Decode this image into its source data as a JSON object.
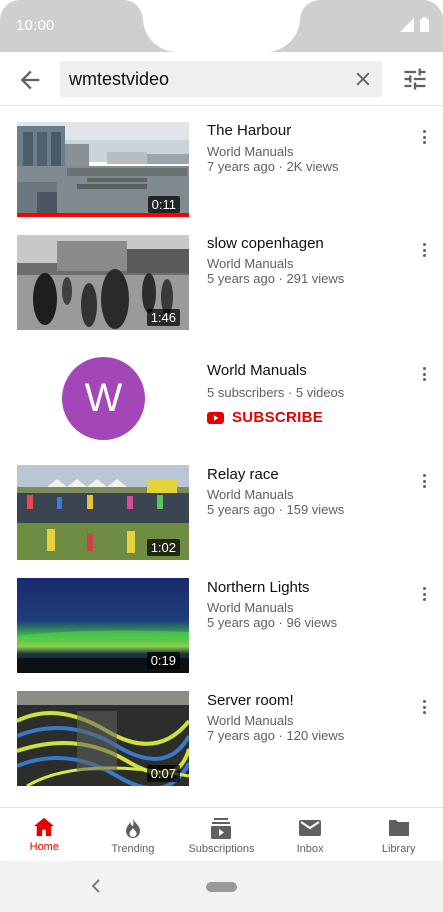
{
  "status_bar": {
    "time": "10:00"
  },
  "search": {
    "query": "wmtestvideo"
  },
  "videos": [
    {
      "title": "The Harbour",
      "channel": "World Manuals",
      "meta": "7 years ago · 2K views",
      "duration": "0:11",
      "watched_fraction": 1.0
    },
    {
      "title": "slow copenhagen",
      "channel": "World Manuals",
      "meta": "5 years ago · 291 views",
      "duration": "1:46"
    },
    {
      "title": "Relay race",
      "channel": "World Manuals",
      "meta": "5 years ago · 159 views",
      "duration": "1:02"
    },
    {
      "title": "Northern Lights",
      "channel": "World Manuals",
      "meta": "5 years ago · 96 views",
      "duration": "0:19"
    },
    {
      "title": "Server room!",
      "channel": "World Manuals",
      "meta": "7 years ago · 120 views",
      "duration": "0:07"
    }
  ],
  "channel_result": {
    "avatar_letter": "W",
    "name": "World Manuals",
    "meta": "5 subscribers · 5 videos",
    "subscribe_label": "SUBSCRIBE",
    "avatar_color": "#a347b8"
  },
  "bottom_nav": [
    {
      "label": "Home",
      "icon": "home-icon",
      "active": true
    },
    {
      "label": "Trending",
      "icon": "trending-icon"
    },
    {
      "label": "Subscriptions",
      "icon": "subscriptions-icon"
    },
    {
      "label": "Inbox",
      "icon": "inbox-icon"
    },
    {
      "label": "Library",
      "icon": "library-icon"
    }
  ],
  "colors": {
    "accent": "#e60000",
    "secondary_text": "#606060"
  }
}
